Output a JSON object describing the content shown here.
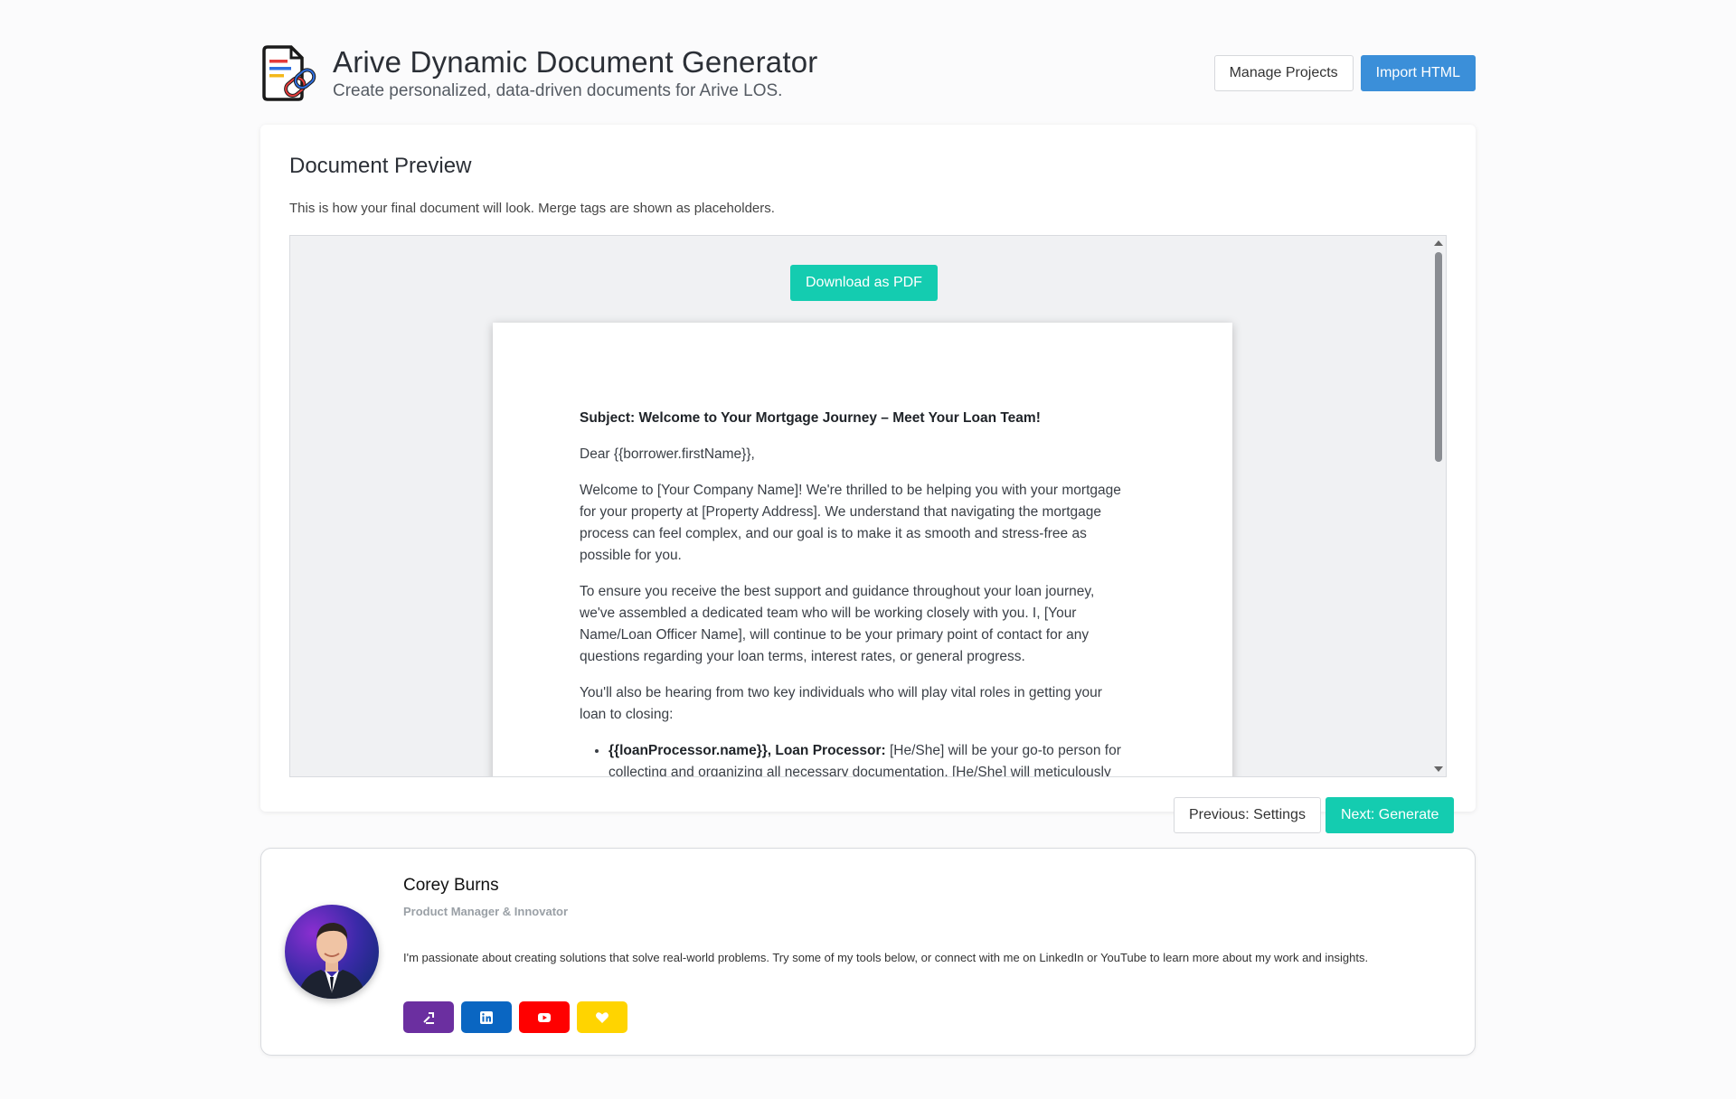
{
  "header": {
    "title": "Arive Dynamic Document Generator",
    "subtitle": "Create personalized, data-driven documents for Arive LOS.",
    "logo_icon": "document-link-icon",
    "buttons": {
      "manage_projects": "Manage Projects",
      "import_html": "Import HTML"
    }
  },
  "preview": {
    "title": "Document Preview",
    "description": "This is how your final document will look. Merge tags are shown as placeholders.",
    "download_label": "Download as PDF",
    "document": {
      "subject": "Subject: Welcome to Your Mortgage Journey – Meet Your Loan Team!",
      "greeting": "Dear {{borrower.firstName}},",
      "para1": "Welcome to [Your Company Name]! We're thrilled to be helping you with your mortgage for your property at [Property Address]. We understand that navigating the mortgage process can feel complex, and our goal is to make it as smooth and stress-free as possible for you.",
      "para2": "To ensure you receive the best support and guidance throughout your loan journey, we've assembled a dedicated team who will be working closely with you. I, [Your Name/Loan Officer Name], will continue to be your primary point of contact for any questions regarding your loan terms, interest rates, or general progress.",
      "para3": "You'll also be hearing from two key individuals who will play vital roles in getting your loan to closing:",
      "list": [
        {
          "strong": "{{loanProcessor.name}}, Loan Processor:",
          "text": " [He/She] will be your go-to person for collecting and organizing all necessary documentation. [He/She] will meticulously"
        }
      ]
    }
  },
  "nav": {
    "previous": "Previous: Settings",
    "next": "Next: Generate"
  },
  "profile": {
    "name": "Corey Burns",
    "role": "Product Manager & Innovator",
    "bio": "I'm passionate about creating solutions that solve real-world problems. Try some of my tools below, or connect with me on LinkedIn or YouTube to learn more about my work and insights.",
    "socials": [
      {
        "icon": "tools-icon",
        "color": "#6b2fa0"
      },
      {
        "icon": "linkedin-icon",
        "color": "#0a66c2"
      },
      {
        "icon": "youtube-icon",
        "color": "#ff0000"
      },
      {
        "icon": "heart-icon",
        "color": "#ffd400"
      }
    ]
  }
}
